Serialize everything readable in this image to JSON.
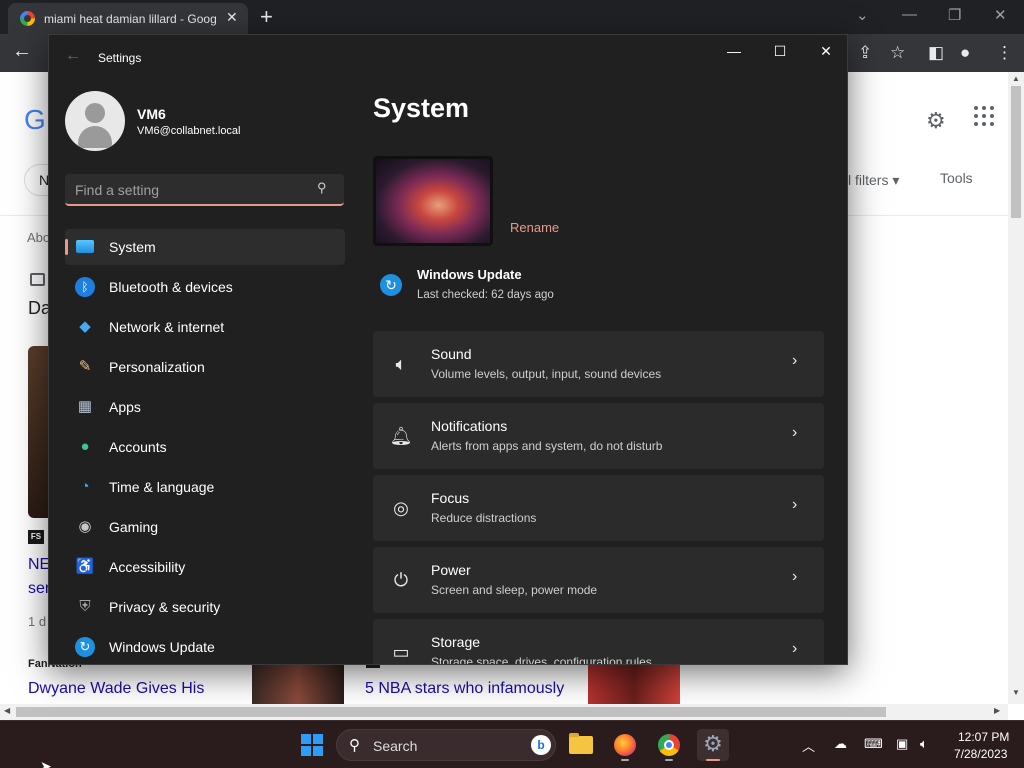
{
  "browser": {
    "tab_title": "miami heat damian lillard - Goog",
    "tab_close": "✕",
    "new_tab": "+",
    "page": {
      "logo_fragment": "G",
      "pill_fragment": "N",
      "filters_fragment": "l filters",
      "tools": "Tools",
      "about_fragment": "Abo",
      "da_fragment": "Da",
      "fs_badge": "FS",
      "ne_fragment": "NE",
      "ser_fragment": "ser",
      "one_d_fragment": "1 d",
      "source_fragment": "FanNation",
      "headline_1": "Dwyane Wade Gives His",
      "headline_2": "5 NBA stars who infamously"
    }
  },
  "settings": {
    "window_title": "Settings",
    "user": {
      "name": "VM6",
      "email": "VM6@collabnet.local"
    },
    "search": {
      "placeholder": "Find a setting"
    },
    "nav": [
      {
        "label": "System",
        "icon": "system-icon",
        "active": true
      },
      {
        "label": "Bluetooth & devices",
        "icon": "bluetooth-icon"
      },
      {
        "label": "Network & internet",
        "icon": "network-icon"
      },
      {
        "label": "Personalization",
        "icon": "brush-icon"
      },
      {
        "label": "Apps",
        "icon": "apps-icon"
      },
      {
        "label": "Accounts",
        "icon": "accounts-icon"
      },
      {
        "label": "Time & language",
        "icon": "time-language-icon"
      },
      {
        "label": "Gaming",
        "icon": "gamepad-icon"
      },
      {
        "label": "Accessibility",
        "icon": "accessibility-icon"
      },
      {
        "label": "Privacy & security",
        "icon": "shield-icon"
      },
      {
        "label": "Windows Update",
        "icon": "windows-update-icon"
      }
    ],
    "main": {
      "title": "System",
      "rename": "Rename",
      "update": {
        "title": "Windows Update",
        "subtitle": "Last checked: 62 days ago"
      },
      "cards": [
        {
          "title": "Sound",
          "subtitle": "Volume levels, output, input, sound devices",
          "icon": "speaker-icon"
        },
        {
          "title": "Notifications",
          "subtitle": "Alerts from apps and system, do not disturb",
          "icon": "bell-icon"
        },
        {
          "title": "Focus",
          "subtitle": "Reduce distractions",
          "icon": "focus-icon"
        },
        {
          "title": "Power",
          "subtitle": "Screen and sleep, power mode",
          "icon": "power-icon"
        },
        {
          "title": "Storage",
          "subtitle": "Storage space, drives, configuration rules",
          "icon": "storage-icon"
        }
      ]
    }
  },
  "taskbar": {
    "search_label": "Search",
    "bing_letter": "b",
    "time": "12:07 PM",
    "date": "7/28/2023"
  },
  "colors": {
    "accent": "#e89a8a",
    "window_bg": "#202020",
    "card_bg": "#2b2b2b",
    "taskbar_bg": "#2a1b1d"
  }
}
